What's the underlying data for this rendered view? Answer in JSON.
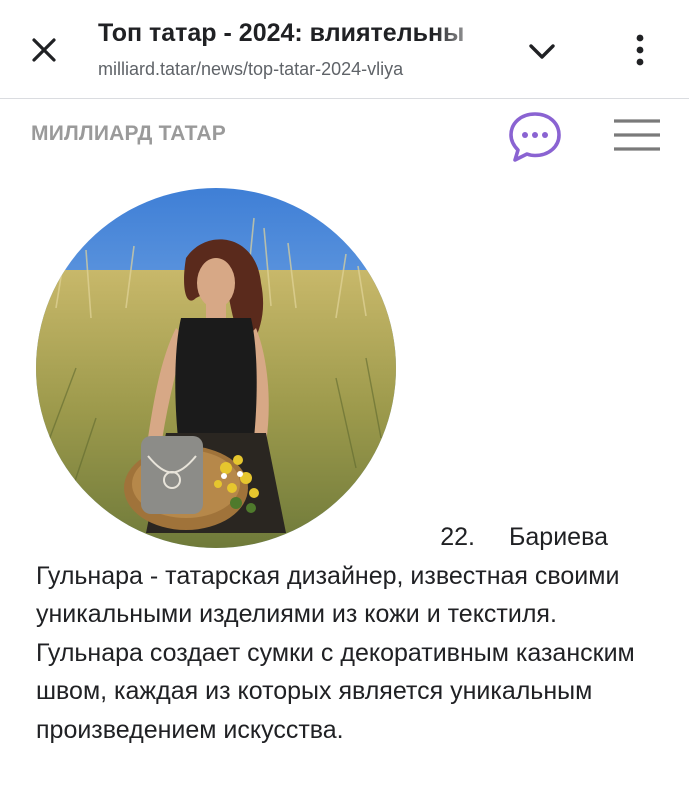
{
  "browser": {
    "page_title": "Топ татар - 2024: влиятельны",
    "url": "milliard.tatar/news/top-tatar-2024-vliya"
  },
  "site": {
    "logo_text": "МИЛЛИАРД ТАТАР",
    "accent_color": "#8a63d2"
  },
  "photo": {
    "alt": "Гульнара Бариева"
  },
  "article": {
    "item_number": "22.",
    "heading_start": "Бариева",
    "body": "Гульнара - татарская дизайнер, известная своими уникальными изделиями из кожи и текстиля. Гульнара создает сумки с декоративным казанским швом, каждая из которых является уникальным произведением искусства."
  },
  "icons": {
    "close": "close-icon",
    "chevron": "chevron-down-icon",
    "more": "more-vertical-icon",
    "chat": "chat-bubble-icon",
    "menu": "hamburger-menu-icon"
  }
}
